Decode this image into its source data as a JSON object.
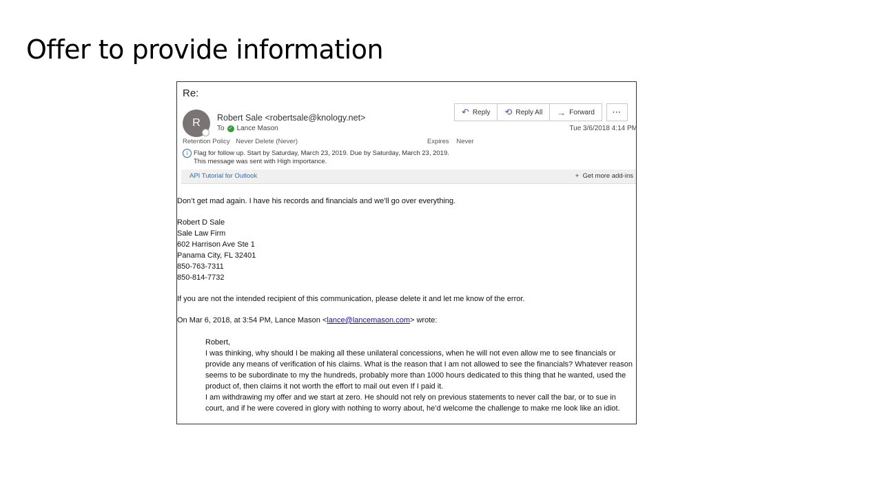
{
  "slide": {
    "title": "Offer to provide information"
  },
  "email": {
    "subject": "Re:",
    "avatar_initial": "R",
    "sender": "Robert Sale <robertsale@knology.net>",
    "to_label": "To",
    "recipient": "Lance Mason",
    "timestamp": "Tue 3/6/2018 4:14 PM",
    "actions": {
      "reply": "Reply",
      "reply_all": "Reply All",
      "forward": "Forward",
      "more": "···"
    },
    "retention_label": "Retention Policy",
    "retention_value": "Never Delete (Never)",
    "expires_label": "Expires",
    "expires_value": "Never",
    "flag_line1": "Flag for follow up.  Start by Saturday, March 23, 2019.  Due by Saturday, March 23, 2019.",
    "flag_line2": "This message was sent with High importance.",
    "addin_link": "API Tutorial for Outlook",
    "get_addins": "Get more add-ins",
    "body_line1": "Don’t get mad again. I have his records and financials and we’ll go over everything.",
    "signature": [
      "Robert D Sale",
      "Sale Law Firm",
      "602 Harrison Ave Ste 1",
      "Panama City, FL 32401",
      "850-763-7311",
      "850-814-7732"
    ],
    "disclaimer": "If you are not the intended recipient of this communication, please delete it and let me know of the error.",
    "quote_intro_before": "On Mar 6, 2018, at 3:54 PM, Lance Mason <",
    "quote_intro_link": "lance@lancemason.com",
    "quote_intro_after": "> wrote:",
    "quoted_greeting": "Robert,",
    "quoted_para1": "I was thinking, why should I be making all these unilateral concessions, when he will not even allow me to see financials or provide any means of verification of his claims. What is the reason that I am not allowed to see the financials? Whatever reason seems to be subordinate to my the hundreds, probably more than 1000 hours dedicated to this thing that he wanted, used the product of, then claims it not worth the effort to mail out even If I paid it.",
    "quoted_para2": "I am withdrawing my offer and we start at zero. He should not rely on previous statements to never call the bar, or to sue in court, and if he were covered in glory with nothing to worry about, he’d welcome the challenge to make me look like an idiot."
  }
}
